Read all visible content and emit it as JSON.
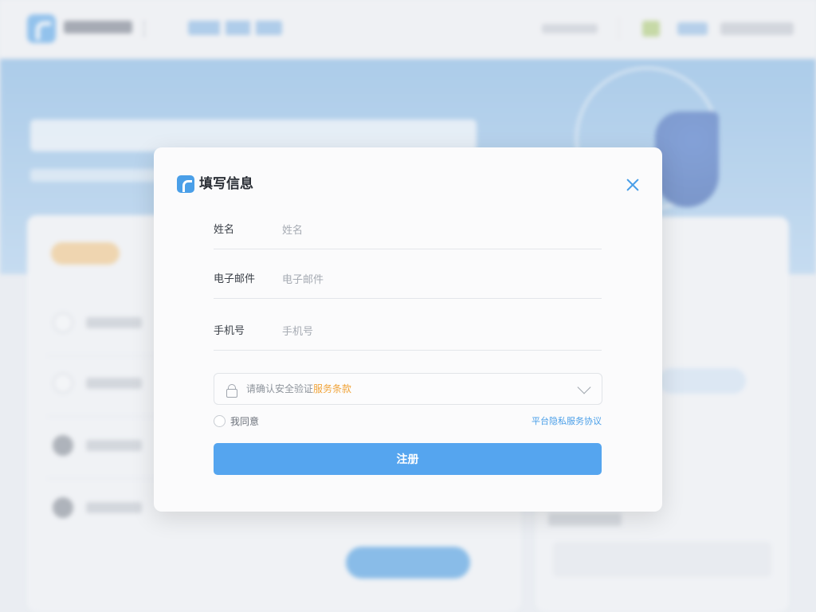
{
  "modal": {
    "title": "填写信息",
    "fields": [
      {
        "label": "姓名",
        "placeholder": "姓名"
      },
      {
        "label": "电子邮件",
        "placeholder": "电子邮件"
      },
      {
        "label": "手机号",
        "placeholder": "手机号"
      }
    ],
    "security_select": {
      "text": "请确认安全验证",
      "highlight": "服务条款"
    },
    "agree_label": "我同意",
    "terms_link": "平台隐私服务协议",
    "submit_label": "注册"
  },
  "icons": {
    "logo": "app-logo-icon",
    "close": "close-icon",
    "lock": "lock-icon",
    "chevron": "chevron-down-icon"
  },
  "colors": {
    "accent": "#4a9fe8",
    "button": "#55a5ef",
    "highlight": "#f0a43a"
  }
}
